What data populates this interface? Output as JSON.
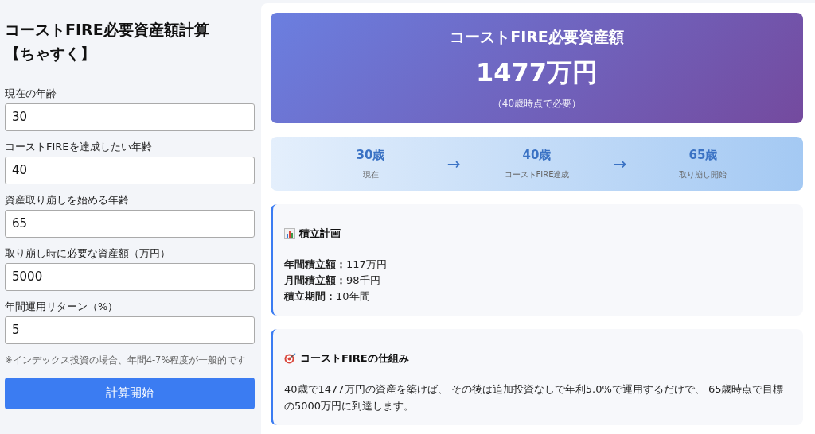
{
  "sidebar": {
    "title": "コーストFIRE必要資産額計算【ちゃすく】",
    "fields": [
      {
        "label": "現在の年齢",
        "value": "30"
      },
      {
        "label": "コーストFIREを達成したい年齢",
        "value": "40"
      },
      {
        "label": "資産取り崩しを始める年齢",
        "value": "65"
      },
      {
        "label": "取り崩し時に必要な資産額（万円）",
        "value": "5000"
      },
      {
        "label": "年間運用リターン（%）",
        "value": "5"
      }
    ],
    "note": "※インデックス投資の場合、年間4-7%程度が一般的です",
    "button": "計算開始"
  },
  "result": {
    "title": "コーストFIRE必要資産額",
    "amount": "1477万円",
    "subtitle": "（40歳時点で必要）"
  },
  "timeline": [
    {
      "age": "30歳",
      "label": "現在"
    },
    {
      "age": "40歳",
      "label": "コーストFIRE達成"
    },
    {
      "age": "65歳",
      "label": "取り崩し開始"
    }
  ],
  "timeline_arrow": "→",
  "cards": [
    {
      "kind": "plan",
      "title": "積立計画",
      "lines": [
        "**年間積立額：**117万円",
        "**月間積立額：**98千円",
        "**積立期間：**10年間"
      ]
    },
    {
      "kind": "target",
      "title": "コーストFIREの仕組み",
      "lines": [
        "40歳で1477万円の資産を築けば、 その後は追加投資なしで年利5.0%で運用するだけで、 65歳時点で目標の5000万円に到達します。"
      ]
    }
  ]
}
